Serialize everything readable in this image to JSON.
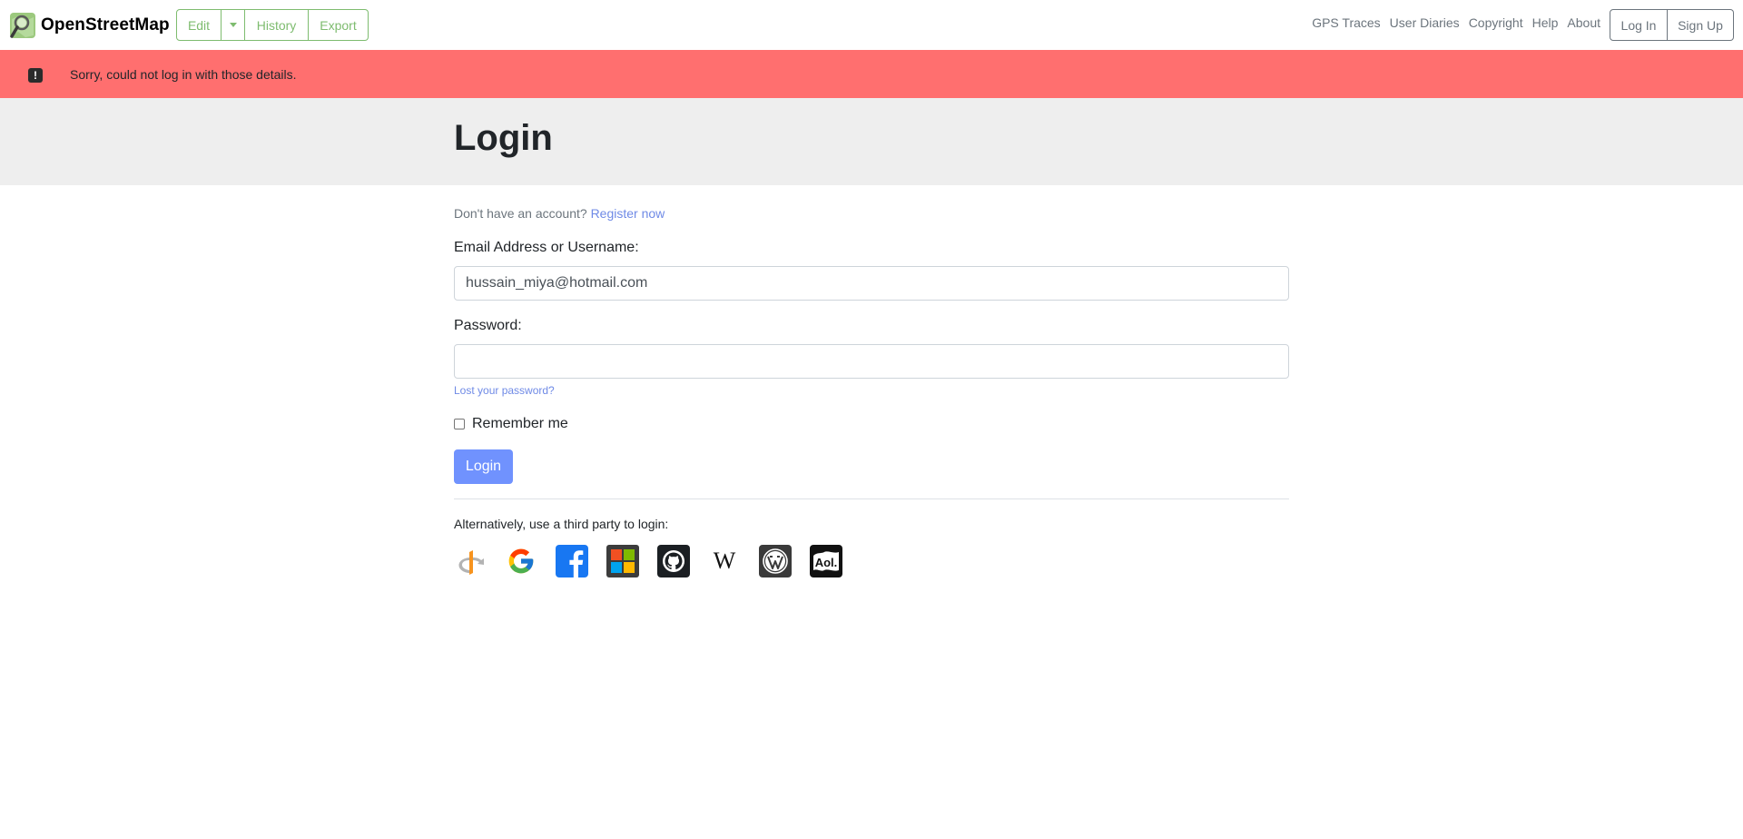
{
  "brand": {
    "name": "OpenStreetMap"
  },
  "nav": {
    "edit_label": "Edit",
    "history_label": "History",
    "export_label": "Export",
    "links": [
      "GPS Traces",
      "User Diaries",
      "Copyright",
      "Help",
      "About"
    ],
    "login_label": "Log In",
    "signup_label": "Sign Up"
  },
  "flash": {
    "message": "Sorry, could not log in with those details."
  },
  "page": {
    "title": "Login"
  },
  "form": {
    "register_prompt": "Don't have an account?",
    "register_link": "Register now",
    "email_label": "Email Address or Username:",
    "email_value": "hussain_miya@hotmail.com",
    "password_label": "Password:",
    "password_value": "",
    "lost_password": "Lost your password?",
    "remember_label": "Remember me",
    "submit_label": "Login"
  },
  "third_party": {
    "text": "Alternatively, use a third party to login:",
    "providers": [
      "openid-icon",
      "google-icon",
      "facebook-icon",
      "microsoft-icon",
      "github-icon",
      "wikipedia-icon",
      "wordpress-icon",
      "aol-icon"
    ]
  },
  "colors": {
    "brand_green": "#7ebc6f",
    "flash_red": "#ff6f6f",
    "link_blue": "#6f8ae6",
    "button_blue": "#7092fe",
    "title_band": "#eeeeee"
  }
}
